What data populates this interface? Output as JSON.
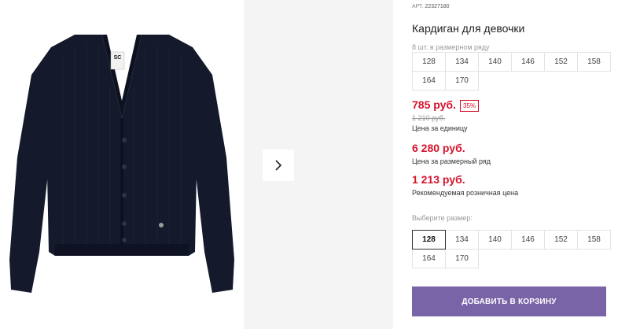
{
  "product": {
    "sku_label": "АРТ.",
    "sku": "22327180",
    "title": "Кардиган для девочки",
    "row_info": "8 шт. в размерном ряду",
    "row_sizes": [
      "128",
      "134",
      "140",
      "146",
      "152",
      "158",
      "164",
      "170"
    ],
    "photo_color": "#141a2b"
  },
  "pricing": {
    "unit_price": "785 руб.",
    "discount": "35%",
    "old_price": "1 210 руб.",
    "unit_caption": "Цена за единицу",
    "row_price": "6 280 руб.",
    "row_caption": "Цена за размерный ряд",
    "rrp_price": "1 213 руб.",
    "rrp_caption": "Рекомендуемая розничная цена",
    "accent_color": "#d6132b"
  },
  "size_select": {
    "label": "Выберите размер:",
    "sizes": [
      "128",
      "134",
      "140",
      "146",
      "152",
      "158",
      "164",
      "170"
    ],
    "selected": "128"
  },
  "cart": {
    "button_label": "ДОБАВИТЬ В КОРЗИНУ",
    "button_color": "#7a64a8"
  },
  "gallery": {
    "next_icon": "chevron-right-icon",
    "logo_text": "SC"
  }
}
